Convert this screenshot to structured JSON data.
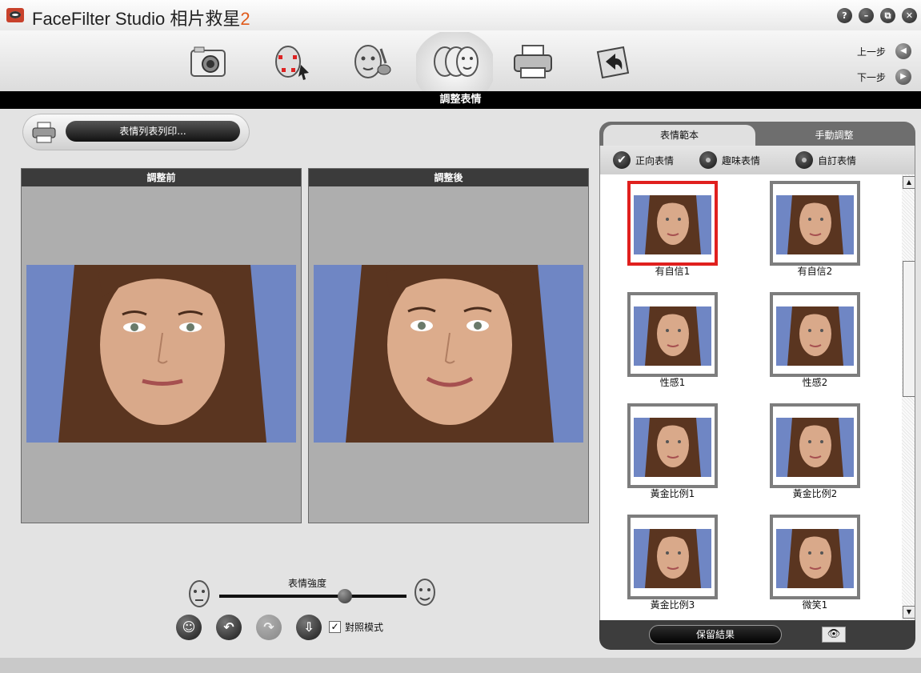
{
  "window": {
    "title": "FaceFilter Studio 相片救星",
    "title_number": "2",
    "help_icon": "?",
    "minimize_icon": "minimize",
    "restore_icon": "restore",
    "close_icon": "x"
  },
  "toolbar": {
    "tools": [
      "camera-icon",
      "face-points-icon",
      "face-retouch-icon",
      "face-expression-icon",
      "printer-icon",
      "exit-folder-icon"
    ],
    "prev_label": "上一步",
    "next_label": "下一步"
  },
  "step_title": "調整表情",
  "print_list_label": "表情列表列印...",
  "panels": {
    "before_label": "調整前",
    "after_label": "調整後"
  },
  "strength": {
    "label": "表情強度",
    "value": 0.67
  },
  "controls": {
    "compare_label": "對照模式",
    "compare_checked": true
  },
  "right_panel": {
    "tabs": [
      "表情範本",
      "手動調整"
    ],
    "active_tab": 0,
    "categories": [
      "正向表情",
      "趣味表情",
      "自訂表情"
    ],
    "selected_category": 0,
    "items": [
      "有自信1",
      "有自信2",
      "性感1",
      "性感2",
      "黃金比例1",
      "黃金比例2",
      "黃金比例3",
      "微笑1"
    ],
    "selected_item": 0,
    "keep_label": "保留結果"
  },
  "colors": {
    "accent": "#e0201e",
    "title_number": "#e05a1a",
    "photo_bg": "#6f86c4",
    "hair": "#5a3520",
    "skin": "#d9a98a"
  }
}
